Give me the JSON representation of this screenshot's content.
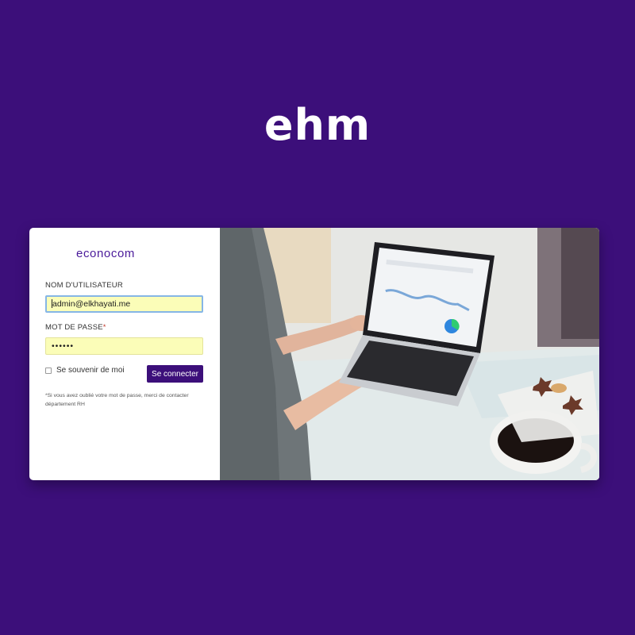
{
  "brand": {
    "title": "ehm"
  },
  "login": {
    "logo_text": "econocom",
    "username_label": "NOM D'UTILISATEUR",
    "username_value": "admin@elkhayati.me",
    "password_label": "MOT DE PASSE",
    "password_required_mark": "*",
    "password_value": "••••••",
    "remember_label": "Se souvenir de moi",
    "remember_checked": false,
    "submit_label": "Se connecter",
    "note": "*Si vous avez oublié votre mot de passe, merci de contacter département RH"
  },
  "colors": {
    "background": "#3c0f7a",
    "accent": "#3c0f7a",
    "logo": "#4a1a9a",
    "field_fill": "#fbfdb8",
    "focus_border": "#86b6e6"
  },
  "photo": {
    "subject": "person typing on a laptop showing analytics dashboard, coffee cup and star cookies"
  }
}
